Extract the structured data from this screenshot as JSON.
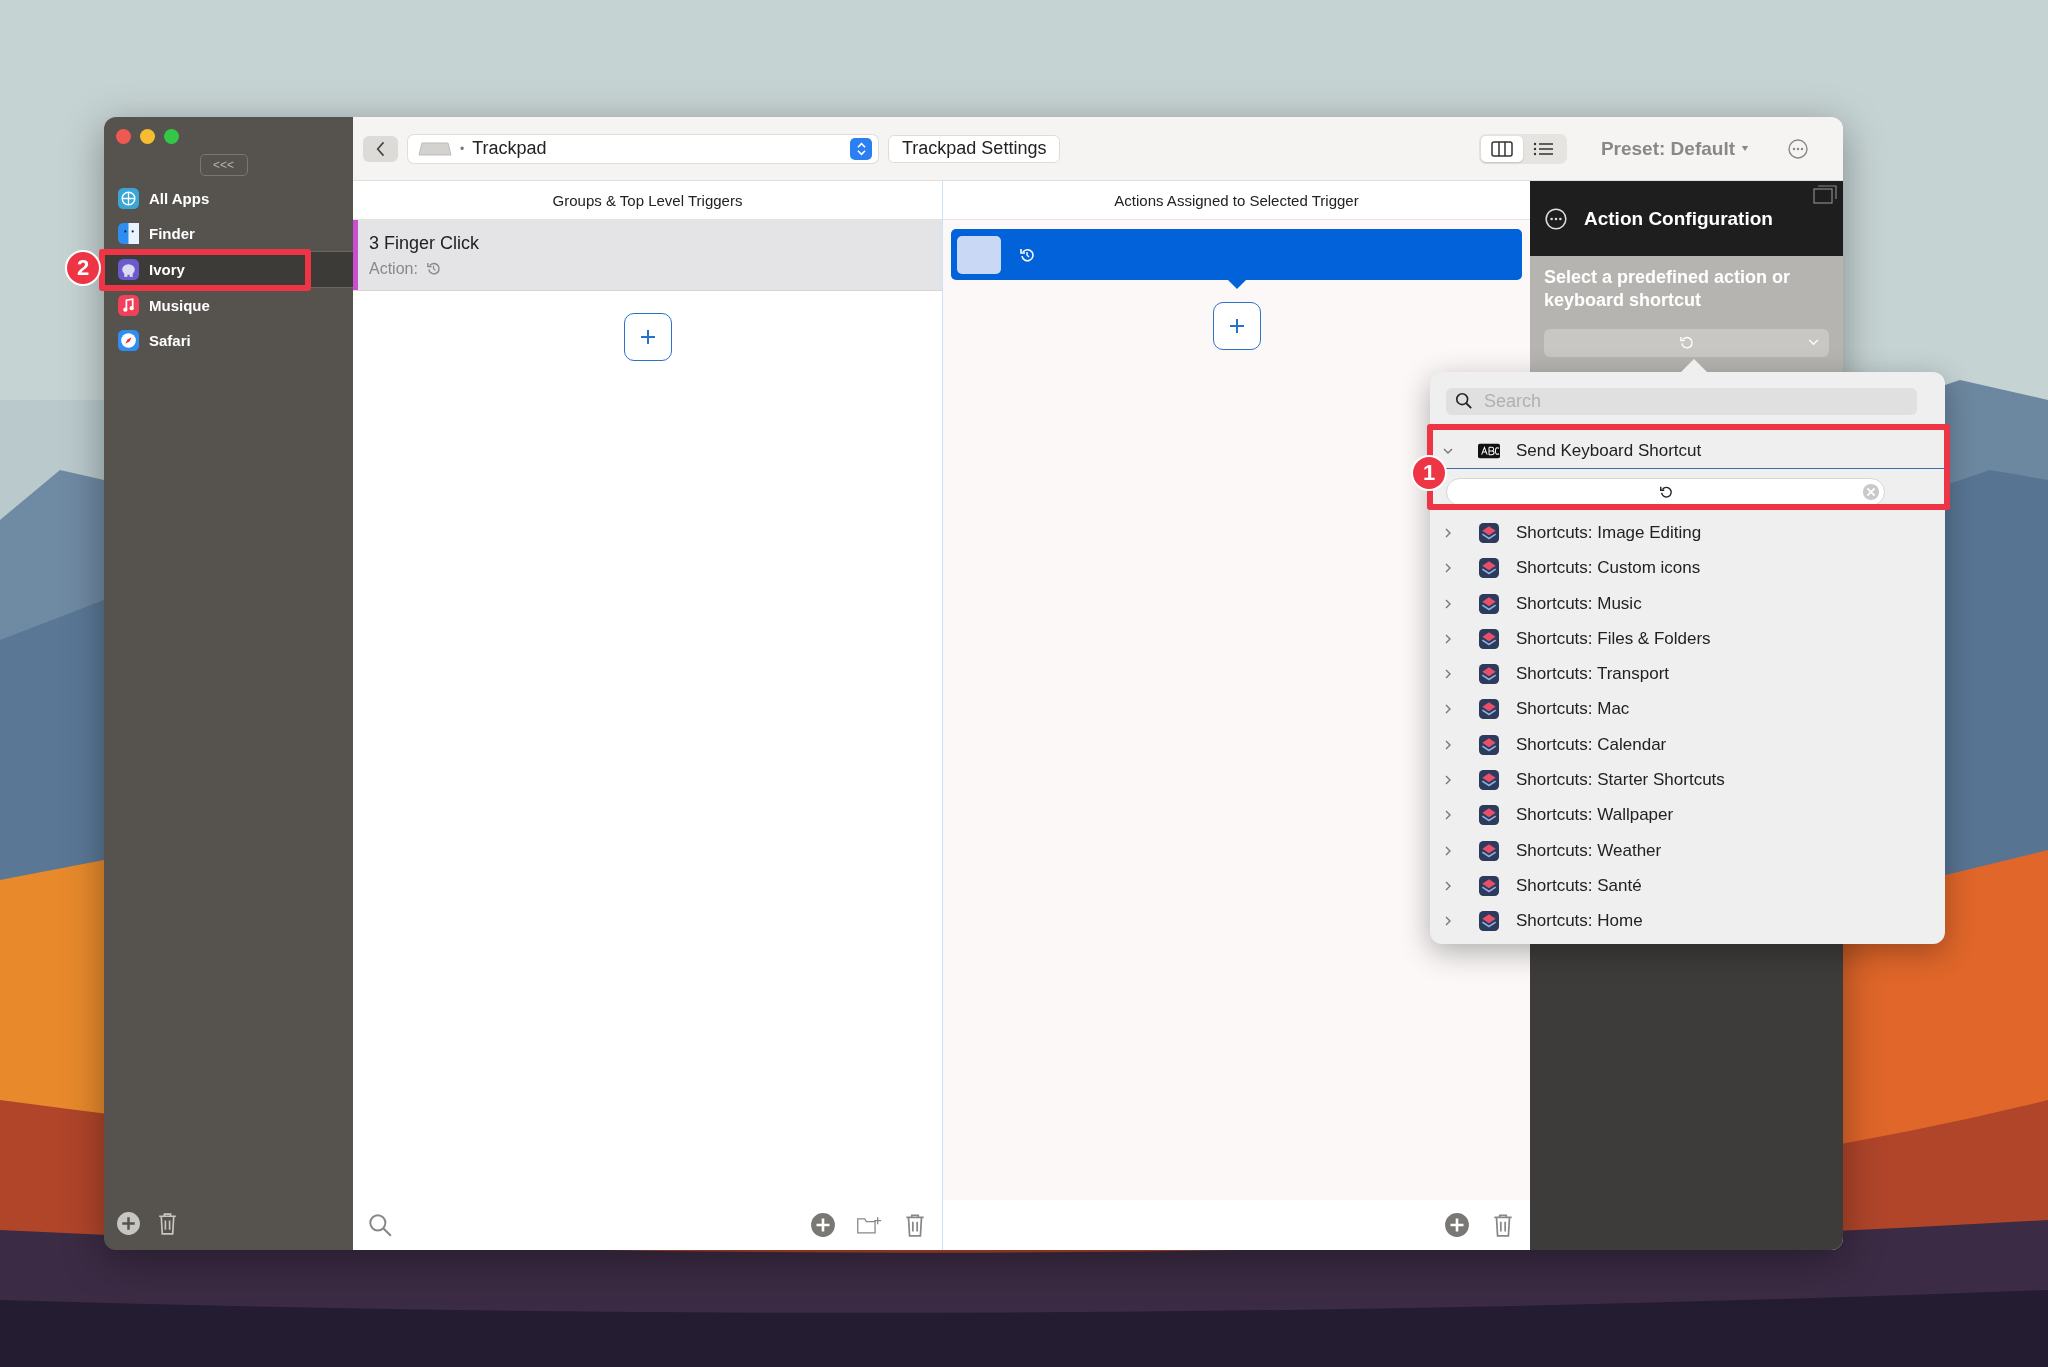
{
  "sidebar": {
    "collapse_label": "<<<",
    "apps": [
      {
        "name": "All Apps",
        "kind": "globe",
        "selected": false
      },
      {
        "name": "Finder",
        "kind": "finder",
        "selected": false
      },
      {
        "name": "Ivory",
        "kind": "elephant",
        "selected": true
      },
      {
        "name": "Musique",
        "kind": "music",
        "selected": false
      },
      {
        "name": "Safari",
        "kind": "safari",
        "selected": false
      }
    ]
  },
  "toolbar": {
    "separator": "•",
    "device": "Trackpad",
    "settings_button": "Trackpad Settings",
    "views": [
      {
        "kind": "columns",
        "selected": true
      },
      {
        "kind": "list",
        "selected": false
      }
    ],
    "preset": "Preset: Default"
  },
  "triggers": {
    "header": "Groups & Top Level Triggers",
    "items": [
      {
        "title": "3 Finger Click",
        "action_label": "Action:",
        "selected": true,
        "color": "#c94fd0"
      }
    ]
  },
  "actions": {
    "header": "Actions Assigned to Selected Trigger",
    "items": [
      {
        "selected": true
      }
    ]
  },
  "config": {
    "title": "Action Configuration",
    "prompt": "Select a predefined action or keyboard shortcut"
  },
  "popup": {
    "search": {
      "placeholder": "Search"
    },
    "items": [
      {
        "label": "Send Keyboard Shortcut",
        "kind": "keyboard",
        "expanded": true
      },
      {
        "label": "Shortcuts: Image Editing",
        "kind": "shortcuts",
        "expanded": false
      },
      {
        "label": "Shortcuts: Custom icons",
        "kind": "shortcuts",
        "expanded": false
      },
      {
        "label": "Shortcuts: Music",
        "kind": "shortcuts",
        "expanded": false
      },
      {
        "label": "Shortcuts: Files & Folders",
        "kind": "shortcuts",
        "expanded": false
      },
      {
        "label": "Shortcuts: Transport",
        "kind": "shortcuts",
        "expanded": false
      },
      {
        "label": "Shortcuts: Mac",
        "kind": "shortcuts",
        "expanded": false
      },
      {
        "label": "Shortcuts: Calendar",
        "kind": "shortcuts",
        "expanded": false
      },
      {
        "label": "Shortcuts: Starter Shortcuts",
        "kind": "shortcuts",
        "expanded": false
      },
      {
        "label": "Shortcuts: Wallpaper",
        "kind": "shortcuts",
        "expanded": false
      },
      {
        "label": "Shortcuts: Weather",
        "kind": "shortcuts",
        "expanded": false
      },
      {
        "label": "Shortcuts: Santé",
        "kind": "shortcuts",
        "expanded": false
      },
      {
        "label": "Shortcuts: Home",
        "kind": "shortcuts",
        "expanded": false
      }
    ]
  },
  "annotations": [
    {
      "number": "1"
    },
    {
      "number": "2"
    }
  ]
}
